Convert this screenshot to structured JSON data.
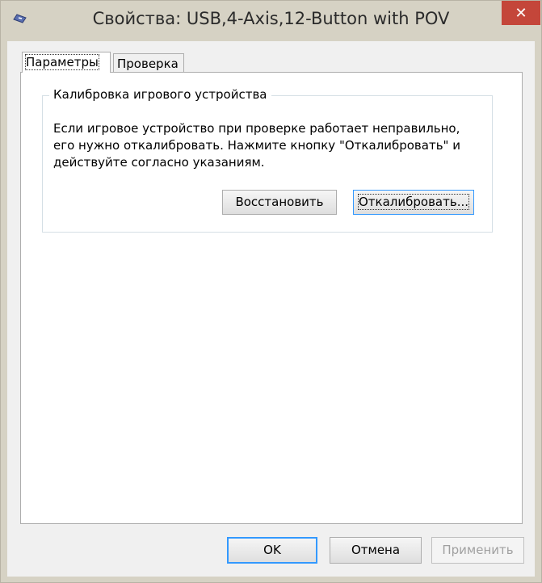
{
  "window": {
    "title": "Свойства: USB,4-Axis,12-Button with POV",
    "app_icon": "gamepad-icon",
    "close_glyph": "✕"
  },
  "tabs": [
    {
      "label": "Параметры",
      "active": true
    },
    {
      "label": "Проверка",
      "active": false
    }
  ],
  "group": {
    "title": "Калибровка игрового устройства",
    "description_lines": [
      "Если игровое устройство при проверке работает неправильно,",
      "его нужно откалибровать. Нажмите кнопку \"Откалибровать\" и",
      "действуйте согласно указаниям."
    ],
    "restore_label": "Восстановить",
    "calibrate_label": "Откалибровать..."
  },
  "footer": {
    "ok_label": "OK",
    "cancel_label": "Отмена",
    "apply_label": "Применить"
  },
  "colors": {
    "close_button": "#c4463a",
    "focus_border": "#3399ff",
    "disabled_text": "#a0a0a0"
  }
}
